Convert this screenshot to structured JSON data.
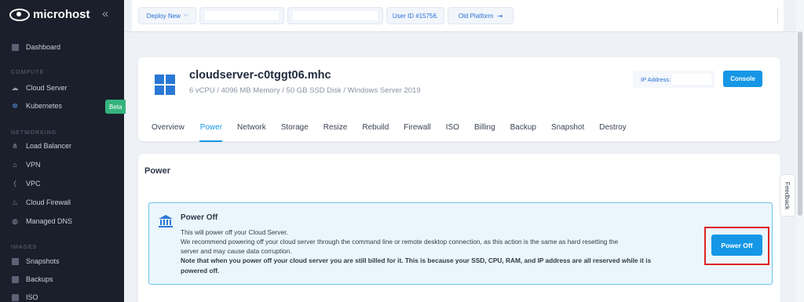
{
  "brand": {
    "name": "microhost"
  },
  "sidebar": {
    "dashboard": "Dashboard",
    "sections": [
      {
        "title": "COMPUTE",
        "items": [
          "Cloud Server",
          "Kubernetes"
        ]
      },
      {
        "title": "NETWORKING",
        "items": [
          "Load Balancer",
          "VPN",
          "VPC",
          "Cloud Firewall",
          "Managed DNS"
        ]
      },
      {
        "title": "IMAGES",
        "items": [
          "Snapshots",
          "Backups",
          "ISO"
        ]
      }
    ],
    "badge": "Beta"
  },
  "topbar": {
    "deploy": "Deploy New",
    "user_id": "User ID #15756.",
    "old_platform": "Old Platform"
  },
  "server": {
    "name": "cloudserver-c0tggt06.mhc",
    "spec": "6 vCPU / 4096 MB Memory / 50 GB SSD Disk / Windows Server 2019",
    "ip_label": "IP Address:",
    "console": "Console",
    "tabs": [
      "Overview",
      "Power",
      "Network",
      "Storage",
      "Resize",
      "Rebuild",
      "Firewall",
      "ISO",
      "Billing",
      "Backup",
      "Snapshot",
      "Destroy"
    ],
    "active_tab": "Power"
  },
  "power": {
    "section_title": "Power",
    "notice_title": "Power Off",
    "line1": "This will power off your Cloud Server.",
    "line2": "We recommend powering off your cloud server through the command line or remote desktop connection, as this action is the same as hard resetting the",
    "line3": "server and may cause data corruption.",
    "line4": "Note that when you power off your cloud server you are still billed for it. This is because your SSD, CPU, RAM, and IP address are all reserved while it is",
    "line5": "powered off.",
    "button": "Power Off"
  },
  "feedback": "Feedback",
  "colors": {
    "accent": "#1597e5",
    "sidebar": "#1b1f2b",
    "highlight": "#e02424",
    "beta": "#34b37e"
  }
}
